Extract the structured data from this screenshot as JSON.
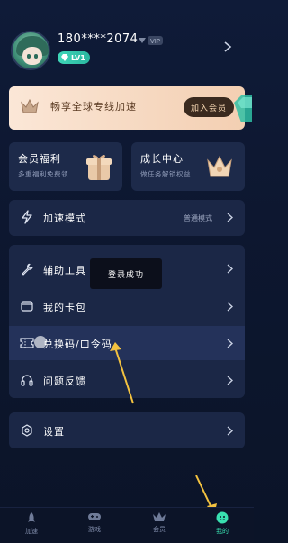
{
  "profile": {
    "phone": "180****2074",
    "vip_tag": "VIP",
    "level": "LV1"
  },
  "banner": {
    "text": "畅享全球专线加速",
    "button": "加入会员"
  },
  "cards": [
    {
      "title": "会员福利",
      "subtitle": "多重福利免费领"
    },
    {
      "title": "成长中心",
      "subtitle": "做任务解锁权益"
    }
  ],
  "accel": {
    "label": "加速模式",
    "value": "普通模式"
  },
  "menu": [
    {
      "label": "辅助工具",
      "icon": "wrench-icon"
    },
    {
      "label": "我的卡包",
      "icon": "wallet-icon"
    },
    {
      "label": "兑换码/口令码",
      "icon": "ticket-icon"
    },
    {
      "label": "问题反馈",
      "icon": "headset-icon"
    }
  ],
  "settings": {
    "label": "设置"
  },
  "toast": "登录成功",
  "nav": [
    {
      "label": "加速",
      "icon": "rocket-icon"
    },
    {
      "label": "游戏",
      "icon": "gamepad-icon"
    },
    {
      "label": "会员",
      "icon": "crown-icon"
    },
    {
      "label": "我的",
      "icon": "profile-icon"
    }
  ],
  "colors": {
    "accent": "#39e0b0",
    "background": "#0f1b38",
    "panel": "#1b2746",
    "banner": "#f6d8c0"
  }
}
